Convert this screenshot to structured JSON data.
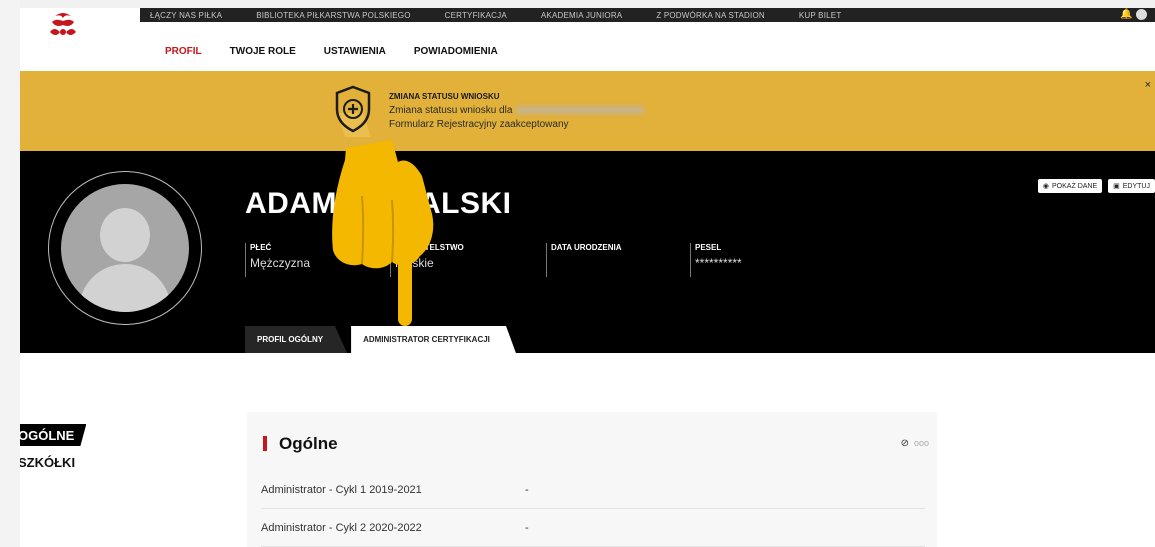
{
  "topnav": {
    "items": [
      "ŁĄCZY NAS PIŁKA",
      "BIBLIOTEKA PIŁKARSTWA POLSKIEGO",
      "CERTYFIKACJA",
      "AKADEMIA JUNIORA",
      "Z PODWÓRKA NA STADION",
      "KUP BILET"
    ]
  },
  "subnav": {
    "items": [
      "PROFIL",
      "TWOJE ROLE",
      "USTAWIENIA",
      "POWIADOMIENIA"
    ]
  },
  "notification": {
    "title": "ZMIANA STATUSU WNIOSKU",
    "line1": "Zmiana statusu wniosku dla",
    "line2": "Formularz Rejestracyjny zaakceptowany",
    "close": "×"
  },
  "profile": {
    "name": "ADAM KOWALSKI",
    "fields": [
      {
        "label": "PŁEĆ",
        "value": "Mężczyzna"
      },
      {
        "label": "OBYWATELSTWO",
        "value": "Polskie"
      },
      {
        "label": "DATA URODZENIA",
        "value": ""
      },
      {
        "label": "PESEL",
        "value": "**********"
      }
    ],
    "buttons": [
      "POKAŻ DANE",
      "EDYTUJ"
    ],
    "tabs": [
      "PROFIL OGÓLNY",
      "ADMINISTRATOR CERTYFIKACJI"
    ]
  },
  "sidebar": {
    "items": [
      "OGÓLNE",
      "SZKÓŁKI"
    ]
  },
  "card": {
    "title": "Ogólne",
    "dots": "ooo",
    "rows": [
      {
        "label": "Administrator - Cykl 1 2019-2021",
        "value": "-"
      },
      {
        "label": "Administrator - Cykl 2 2020-2022",
        "value": "-"
      }
    ]
  },
  "colors": {
    "accent": "#c4161c",
    "banner": "#e1b13a",
    "header": "#000000",
    "pointer": "#f5b800"
  },
  "icons": [
    "logo-icon",
    "bell-icon",
    "shield-plus-icon",
    "close-icon",
    "eye-icon",
    "edit-icon",
    "eye-off-icon",
    "pointing-hand-icon"
  ]
}
